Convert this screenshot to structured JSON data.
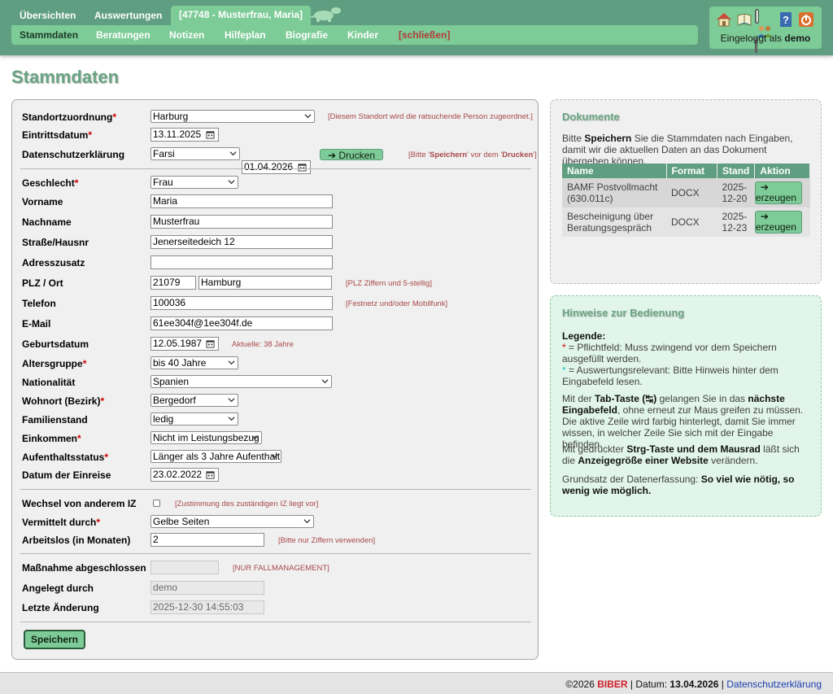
{
  "nav": {
    "top_tabs": [
      {
        "label": "Übersichten"
      },
      {
        "label": "Auswertungen"
      },
      {
        "label": "[47748 - Musterfrau, Maria]"
      }
    ],
    "sub_items": [
      {
        "label": "Stammdaten"
      },
      {
        "label": "Beratungen"
      },
      {
        "label": "Notizen"
      },
      {
        "label": "Hilfeplan"
      },
      {
        "label": "Biografie"
      },
      {
        "label": "Kinder"
      },
      {
        "label": "[schließen]"
      }
    ]
  },
  "user": {
    "logged_in_prefix": "Eingeloggt als",
    "username": "demo",
    "icons": [
      "home-icon",
      "book-icon",
      "users-icon",
      "help-icon",
      "power-icon"
    ]
  },
  "page": {
    "title": "Stammdaten"
  },
  "form": {
    "standort": {
      "label": "Standortzuordnung",
      "value": "Harburg",
      "hint": "[Diesem Standort wird die ratsuchende Person zugeordnet.]"
    },
    "eintritt": {
      "label": "Eintrittsdatum",
      "value": "13.11.2025"
    },
    "datenschutz": {
      "label": "Datenschutzerklärung",
      "language": "Farsi",
      "date": "01.04.2026",
      "print_label": "➔ Drucken",
      "hint_pre": "[Bitte '",
      "hint_b1": "Speichern",
      "hint_mid": "' vor dem '",
      "hint_b2": "Drucken",
      "hint_post": "']"
    },
    "geschlecht": {
      "label": "Geschlecht",
      "value": "Frau"
    },
    "vorname": {
      "label": "Vorname",
      "value": "Maria"
    },
    "nachname": {
      "label": "Nachname",
      "value": "Musterfrau"
    },
    "strasse": {
      "label": "Straße/Hausnr",
      "value": "Jenerseitedeich 12"
    },
    "adresszusatz": {
      "label": "Adresszusatz",
      "value": ""
    },
    "plz_ort": {
      "label": "PLZ / Ort",
      "plz": "21079",
      "ort": "Hamburg",
      "hint": "[PLZ Ziffern und 5-stellig]"
    },
    "telefon": {
      "label": "Telefon",
      "value": "100036",
      "hint": "[Festnetz und/oder Mobilfunk]"
    },
    "email": {
      "label": "E-Mail",
      "value": "61ee304f@1ee304f.de"
    },
    "geburtsdatum": {
      "label": "Geburtsdatum",
      "value": "12.05.1987",
      "hint": "Aktuelle: 38 Jahre"
    },
    "altersgruppe": {
      "label": "Altersgruppe",
      "value": "bis 40 Jahre"
    },
    "nationalitaet": {
      "label": "Nationalität",
      "value": "Spanien"
    },
    "wohnort": {
      "label": "Wohnort (Bezirk)",
      "value": "Bergedorf"
    },
    "familienstand": {
      "label": "Familienstand",
      "value": "ledig"
    },
    "einkommen": {
      "label": "Einkommen",
      "value": "Nicht im Leistungsbezug"
    },
    "aufenthalt": {
      "label": "Aufenthaltsstatus",
      "value": "Länger als 3 Jahre Aufenthalt"
    },
    "einreise": {
      "label": "Datum der Einreise",
      "value": "23.02.2022"
    },
    "wechsel": {
      "label": "Wechsel von anderem IZ",
      "hint": "[Zustimmung des zuständigen IZ liegt vor]"
    },
    "vermittelt": {
      "label": "Vermittelt durch",
      "value": "Gelbe Seiten"
    },
    "arbeitslos": {
      "label": "Arbeitslos (in Monaten)",
      "value": "2",
      "hint": "[Bitte nur Ziffern verwenden]"
    },
    "massnahme": {
      "label": "Maßnahme abgeschlossen",
      "value": "",
      "hint": "[NUR FALLMANAGEMENT]"
    },
    "angelegt": {
      "label": "Angelegt durch",
      "value": "demo"
    },
    "aenderung": {
      "label": "Letzte Änderung",
      "value": "2025-12-30 14:55:03"
    },
    "save_label": "Speichern"
  },
  "docs": {
    "title": "Dokumente",
    "text_pre": "Bitte ",
    "text_b": "Speichern",
    "text_post": " Sie die Stammdaten nach Eingaben, damit wir die aktuellen Daten an das Dokument übergeben können.",
    "columns": [
      "Name",
      "Format",
      "Stand",
      "Aktion"
    ],
    "rows": [
      {
        "name": "BAMF Postvollmacht (630.011c)",
        "format": "DOCX",
        "stand": "2025-12-20",
        "action": "erzeugen"
      },
      {
        "name": "Bescheinigung über Beratungsgespräch",
        "format": "DOCX",
        "stand": "2025-12-23",
        "action": "erzeugen"
      }
    ]
  },
  "help": {
    "title": "Hinweise zur Bedienung",
    "legend_title": "Legende:",
    "legend_1": " = Pflichtfeld: Muss zwingend vor dem Speichern ausgefüllt werden.",
    "legend_2": " = Auswertungsrelevant: Bitte Hinweis hinter dem Eingabefeld lesen.",
    "p1_pre": "Mit der ",
    "p1_b1": "Tab-Taste (↹)",
    "p1_mid": " gelangen Sie in das ",
    "p1_b2": "nächste Eingabefeld",
    "p1_post": ", ohne erneut zur Maus greifen zu müssen. Die aktive Zeile wird farbig hinterlegt, damit Sie immer wissen, in welcher Zeile Sie sich mit der Eingabe befinden.",
    "p2_pre": "Mit gedrückter ",
    "p2_b1": "Strg-Taste und dem Mausrad",
    "p2_mid": " läßt sich die ",
    "p2_b2": "Anzeigegröße einer Website",
    "p2_post": " verändern.",
    "p3_pre": "Grundsatz der Datenerfassung: ",
    "p3_b": "So viel wie nötig, so wenig wie möglich."
  },
  "footer": {
    "copyright": "©2026",
    "brand_a": "BI",
    "brand_b": "BER",
    "date_label": "| Datum:",
    "date": "13.04.2026",
    "sep": "|",
    "link": "Datenschutzerklärung"
  },
  "colors": {
    "header": "#5f9e80",
    "accent": "#7dcb96",
    "title": "#6aa583",
    "required": "#d00000",
    "hint": "#a84848",
    "brand": "#d0202c"
  }
}
